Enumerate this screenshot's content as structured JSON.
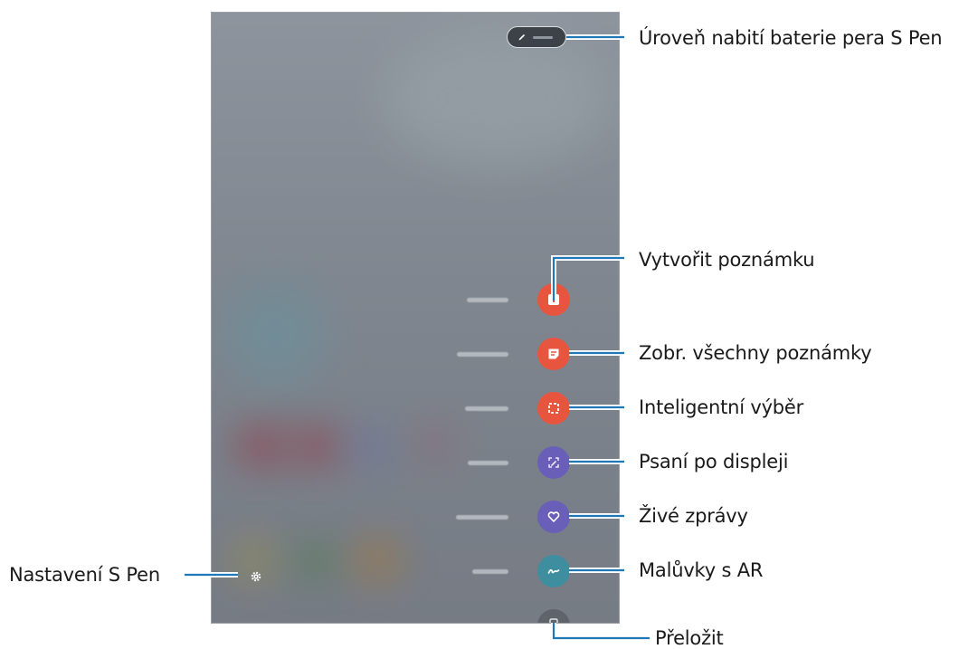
{
  "callouts": {
    "battery": "Úroveň nabití baterie pera S Pen",
    "create_note": "Vytvořit poznámku",
    "view_all_notes": "Zobr. všechny poznámky",
    "smart_select": "Inteligentní výběr",
    "screen_write": "Psaní po displeji",
    "live_messages": "Živé zprávy",
    "ar_doodle": "Malůvky s AR",
    "translate": "Přeložit",
    "settings": "Nastavení S Pen"
  },
  "colors": {
    "create_note": "#e8553f",
    "view_all_notes": "#e8553f",
    "smart_select": "#e8553f",
    "screen_write": "#6a5fb8",
    "live_messages": "#6a5fb8",
    "ar_doodle": "#3f8e9f",
    "translate": "#5f646b",
    "callout_line": "#1f79b8"
  },
  "icons": {
    "battery": "pen-icon",
    "create_note": "note-add-icon",
    "view_all_notes": "notes-list-icon",
    "smart_select": "selection-icon",
    "screen_write": "screen-write-icon",
    "live_messages": "heart-icon",
    "ar_doodle": "doodle-icon",
    "translate": "translate-icon",
    "settings": "gear-icon"
  }
}
